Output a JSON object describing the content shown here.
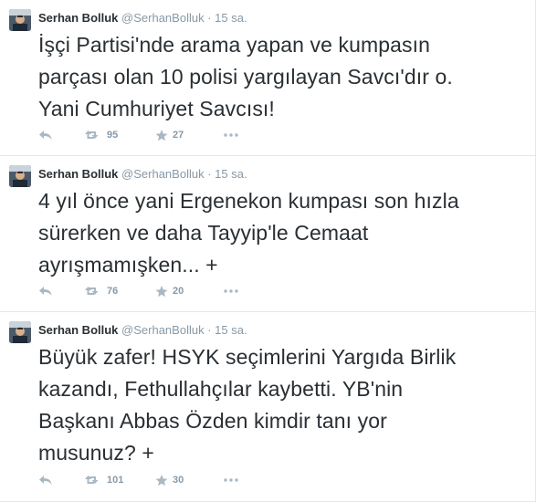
{
  "tweets": [
    {
      "fullname": "Serhan Bolluk",
      "username": "@SerhanBolluk",
      "separator": "·",
      "time": "15 sa.",
      "text_lines": [
        "İşçi Partisi'nde arama yapan ve kumpasın",
        "parçası olan 10 polisi yargılayan Savcı'dır o.",
        "Yani Cumhuriyet Savcısı!"
      ],
      "retweets": "95",
      "favorites": "27"
    },
    {
      "fullname": "Serhan Bolluk",
      "username": "@SerhanBolluk",
      "separator": "·",
      "time": "15 sa.",
      "text_lines": [
        "4 yıl önce yani Ergenekon kumpası son hızla",
        "sürerken ve daha Tayyip'le Cemaat",
        "ayrışmamışken... +"
      ],
      "retweets": "76",
      "favorites": "20"
    },
    {
      "fullname": "Serhan Bolluk",
      "username": "@SerhanBolluk",
      "separator": "·",
      "time": "15 sa.",
      "text_lines": [
        "Büyük zafer! HSYK seçimlerini Yargıda Birlik",
        "kazandı, Fethullahçılar kaybetti. YB'nin",
        "Başkanı Abbas Özden kimdir tanı yor",
        "musunuz? +"
      ],
      "retweets": "101",
      "favorites": "30"
    }
  ],
  "colors": {
    "text": "#292f33",
    "muted": "#8899a6",
    "divider": "#e1e8ed",
    "icon": "#aab8c2"
  },
  "icons": {
    "reply": "reply-icon",
    "retweet": "retweet-icon",
    "favorite": "star-icon",
    "more": "more-icon"
  }
}
